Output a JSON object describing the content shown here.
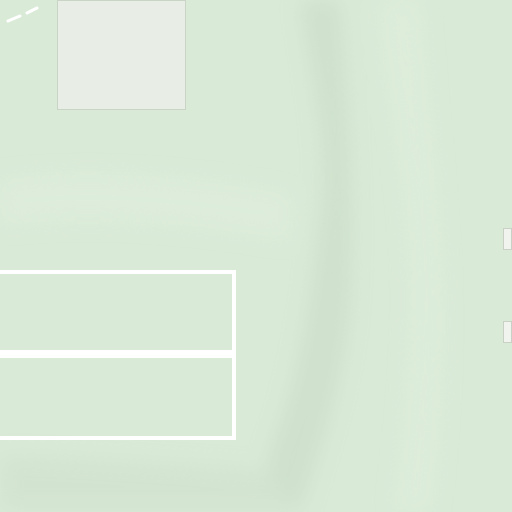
{
  "map": {
    "colors": {
      "land": "#d9ead7",
      "building_fill": "#e8ede6",
      "building_outline": "#c9d3c6",
      "court_lines": "#ffffff",
      "path_dash": "#ffffff",
      "marker_fill": "#f1f3ef"
    },
    "features": [
      "building",
      "sports-court",
      "footpath",
      "edge-marker"
    ]
  }
}
